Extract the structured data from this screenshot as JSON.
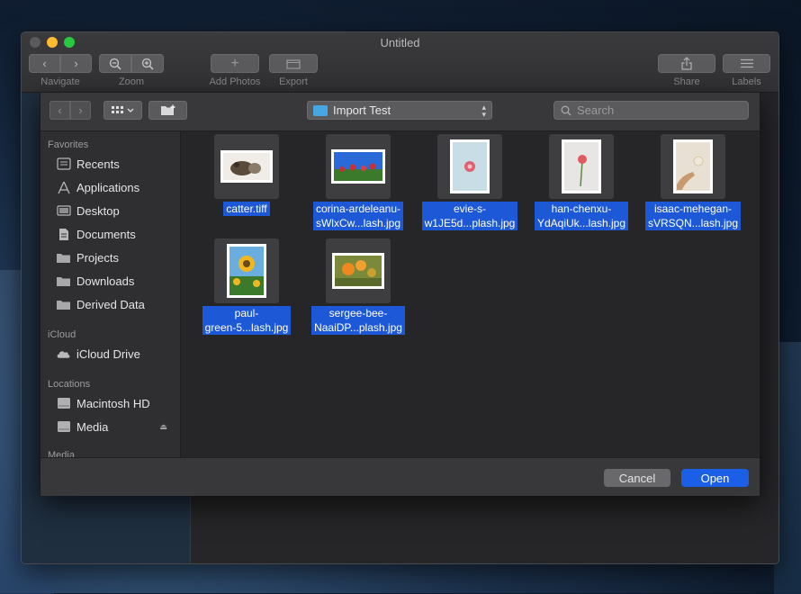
{
  "window": {
    "title": "Untitled",
    "toolbar": {
      "navigate_label": "Navigate",
      "zoom_label": "Zoom",
      "add_photos_label": "Add Photos",
      "export_label": "Export",
      "share_label": "Share",
      "labels_label": "Labels"
    }
  },
  "dialog": {
    "location": "Import Test",
    "search_placeholder": "Search",
    "sidebar": {
      "favorites_heading": "Favorites",
      "favorites": [
        {
          "label": "Recents",
          "icon": "recents-icon"
        },
        {
          "label": "Applications",
          "icon": "applications-icon"
        },
        {
          "label": "Desktop",
          "icon": "desktop-icon"
        },
        {
          "label": "Documents",
          "icon": "documents-icon"
        },
        {
          "label": "Projects",
          "icon": "folder-icon"
        },
        {
          "label": "Downloads",
          "icon": "folder-icon"
        },
        {
          "label": "Derived Data",
          "icon": "folder-icon"
        }
      ],
      "icloud_heading": "iCloud",
      "icloud": [
        {
          "label": "iCloud Drive",
          "icon": "cloud-icon"
        }
      ],
      "locations_heading": "Locations",
      "locations": [
        {
          "label": "Macintosh HD",
          "icon": "disk-icon"
        },
        {
          "label": "Media",
          "icon": "disk-icon",
          "eject": "⏏"
        }
      ],
      "media_heading": "Media"
    },
    "files": [
      {
        "line1": "catter.tiff",
        "line2": "",
        "orientation": "landscape",
        "palette": [
          "#f0ede8",
          "#5a4a3a",
          "#8a7a6a"
        ]
      },
      {
        "line1": "corina-ardeleanu-",
        "line2": "sWlxCw...lash.jpg",
        "orientation": "landscape",
        "palette": [
          "#2a6ad8",
          "#c83030",
          "#3a7a2a"
        ]
      },
      {
        "line1": "evie-s-",
        "line2": "w1JE5d...plash.jpg",
        "orientation": "portrait",
        "palette": [
          "#c9dde6",
          "#e06070",
          "#b8d0da"
        ]
      },
      {
        "line1": "han-chenxu-",
        "line2": "YdAqiUk...lash.jpg",
        "orientation": "portrait",
        "palette": [
          "#e8e6e4",
          "#e05a60",
          "#5a8a4a"
        ]
      },
      {
        "line1": "isaac-mehegan-",
        "line2": "sVRSQN...lash.jpg",
        "orientation": "portrait",
        "palette": [
          "#e8e0d2",
          "#c89a70",
          "#f0e8d8"
        ]
      },
      {
        "line1": "paul-",
        "line2": "green-5...lash.jpg",
        "orientation": "portrait",
        "palette": [
          "#6aaee0",
          "#f0b820",
          "#3a7a2a"
        ]
      },
      {
        "line1": "sergee-bee-",
        "line2": "NaaiDP...plash.jpg",
        "orientation": "landscape",
        "palette": [
          "#7a8a3a",
          "#f08820",
          "#c8a030"
        ]
      }
    ],
    "cancel_label": "Cancel",
    "open_label": "Open"
  }
}
